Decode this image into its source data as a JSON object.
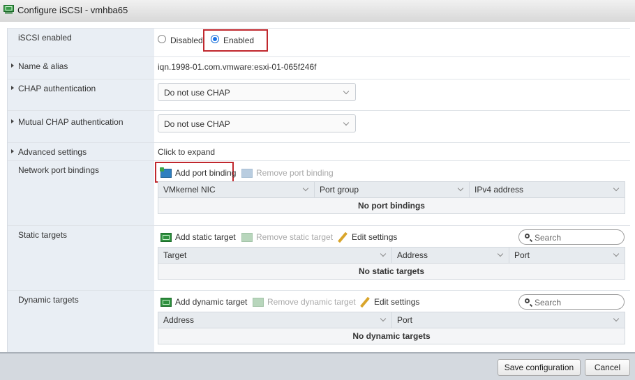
{
  "window": {
    "title": "Configure iSCSI - vmhba65",
    "icon": "iscsi-adapter-icon"
  },
  "iscsi_enabled": {
    "label": "iSCSI enabled",
    "options": [
      {
        "label": "Disabled",
        "selected": false
      },
      {
        "label": "Enabled",
        "selected": true
      }
    ]
  },
  "name_alias": {
    "label": "Name & alias",
    "value": "iqn.1998-01.com.vmware:esxi-01-065f246f"
  },
  "chap": {
    "label": "CHAP authentication",
    "selected": "Do not use CHAP"
  },
  "mutual_chap": {
    "label": "Mutual CHAP authentication",
    "selected": "Do not use CHAP"
  },
  "advanced": {
    "label": "Advanced settings",
    "value": "Click to expand"
  },
  "port_bindings": {
    "label": "Network port bindings",
    "add_label": "Add port binding",
    "remove_label": "Remove port binding",
    "columns": [
      "VMkernel NIC",
      "Port group",
      "IPv4 address"
    ],
    "empty_text": "No port bindings"
  },
  "static_targets": {
    "label": "Static targets",
    "add_label": "Add static target",
    "remove_label": "Remove static target",
    "edit_label": "Edit settings",
    "search_placeholder": "Search",
    "columns": [
      "Target",
      "Address",
      "Port"
    ],
    "empty_text": "No static targets"
  },
  "dynamic_targets": {
    "label": "Dynamic targets",
    "add_label": "Add dynamic target",
    "remove_label": "Remove dynamic target",
    "edit_label": "Edit settings",
    "search_placeholder": "Search",
    "columns": [
      "Address",
      "Port"
    ],
    "empty_text": "No dynamic targets"
  },
  "footer": {
    "save_label": "Save configuration",
    "cancel_label": "Cancel"
  },
  "colors": {
    "highlight_box": "#c0272d",
    "label_column_bg": "#e9eef4",
    "radio_selected": "#1a73e8"
  }
}
